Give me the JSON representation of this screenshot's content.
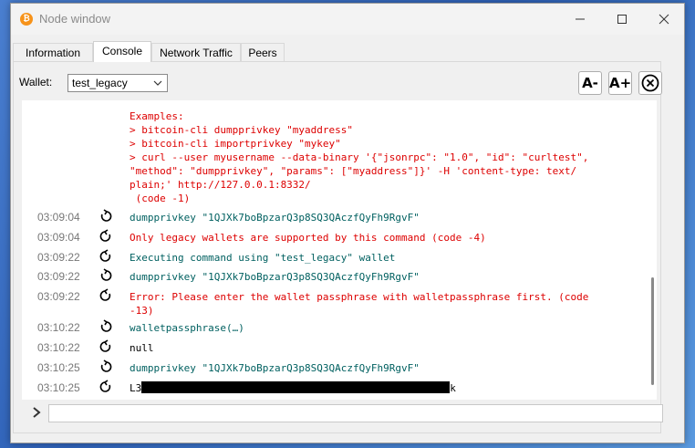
{
  "window": {
    "title": "Node window",
    "app_icon": "bitcoin-icon",
    "controls": [
      "minimize-icon",
      "maximize-icon",
      "close-icon"
    ]
  },
  "tabs": [
    {
      "label": "Information",
      "active": false
    },
    {
      "label": "Console",
      "active": true
    },
    {
      "label": "Network Traffic",
      "active": false
    },
    {
      "label": "Peers",
      "active": false
    }
  ],
  "wallet": {
    "label": "Wallet:",
    "selected": "test_legacy"
  },
  "font_controls": {
    "decrease": "A-",
    "increase": "A+",
    "clear_icon": "clear-console-icon"
  },
  "console": {
    "help_text": [
      "Examples:",
      "> bitcoin-cli dumpprivkey \"myaddress\"",
      "> bitcoin-cli importprivkey \"mykey\"",
      "> curl --user myusername --data-binary '{\"jsonrpc\": \"1.0\", \"id\": \"curltest\",",
      "\"method\": \"dumpprivkey\", \"params\": [\"myaddress\"]}' -H 'content-type: text/",
      "plain;' http://127.0.0.1:8332/",
      " (code -1)"
    ],
    "entries": [
      {
        "time": "03:09:04",
        "type": "command",
        "text": "dumpprivkey \"1QJXk7boBpzarQ3p8SQ3QAczfQyFh9RgvF\""
      },
      {
        "time": "03:09:04",
        "type": "error",
        "text": "Only legacy wallets are supported by this command (code -4)"
      },
      {
        "time": "03:09:22",
        "type": "command",
        "text": "Executing command using \"test_legacy\" wallet"
      },
      {
        "time": "03:09:22",
        "type": "command",
        "text": "dumpprivkey \"1QJXk7boBpzarQ3p8SQ3QAczfQyFh9RgvF\""
      },
      {
        "time": "03:09:22",
        "type": "error",
        "text": "Error: Please enter the wallet passphrase with walletpassphrase first. (code\n-13)"
      },
      {
        "time": "03:10:22",
        "type": "command",
        "text": "walletpassphrase(…)"
      },
      {
        "time": "03:10:22",
        "type": "output",
        "text": "null"
      },
      {
        "time": "03:10:25",
        "type": "command",
        "text": "dumpprivkey \"1QJXk7boBpzarQ3p8SQ3QAczfQyFh9RgvF\""
      },
      {
        "time": "03:10:25",
        "type": "output",
        "text_prefix": "L3",
        "text_suffix": "k",
        "redacted": true
      }
    ]
  },
  "input": {
    "value": "",
    "prompt_icon": "chevron-right-icon"
  },
  "colors": {
    "command": "#006060",
    "error": "#d00000",
    "time": "#777777"
  }
}
